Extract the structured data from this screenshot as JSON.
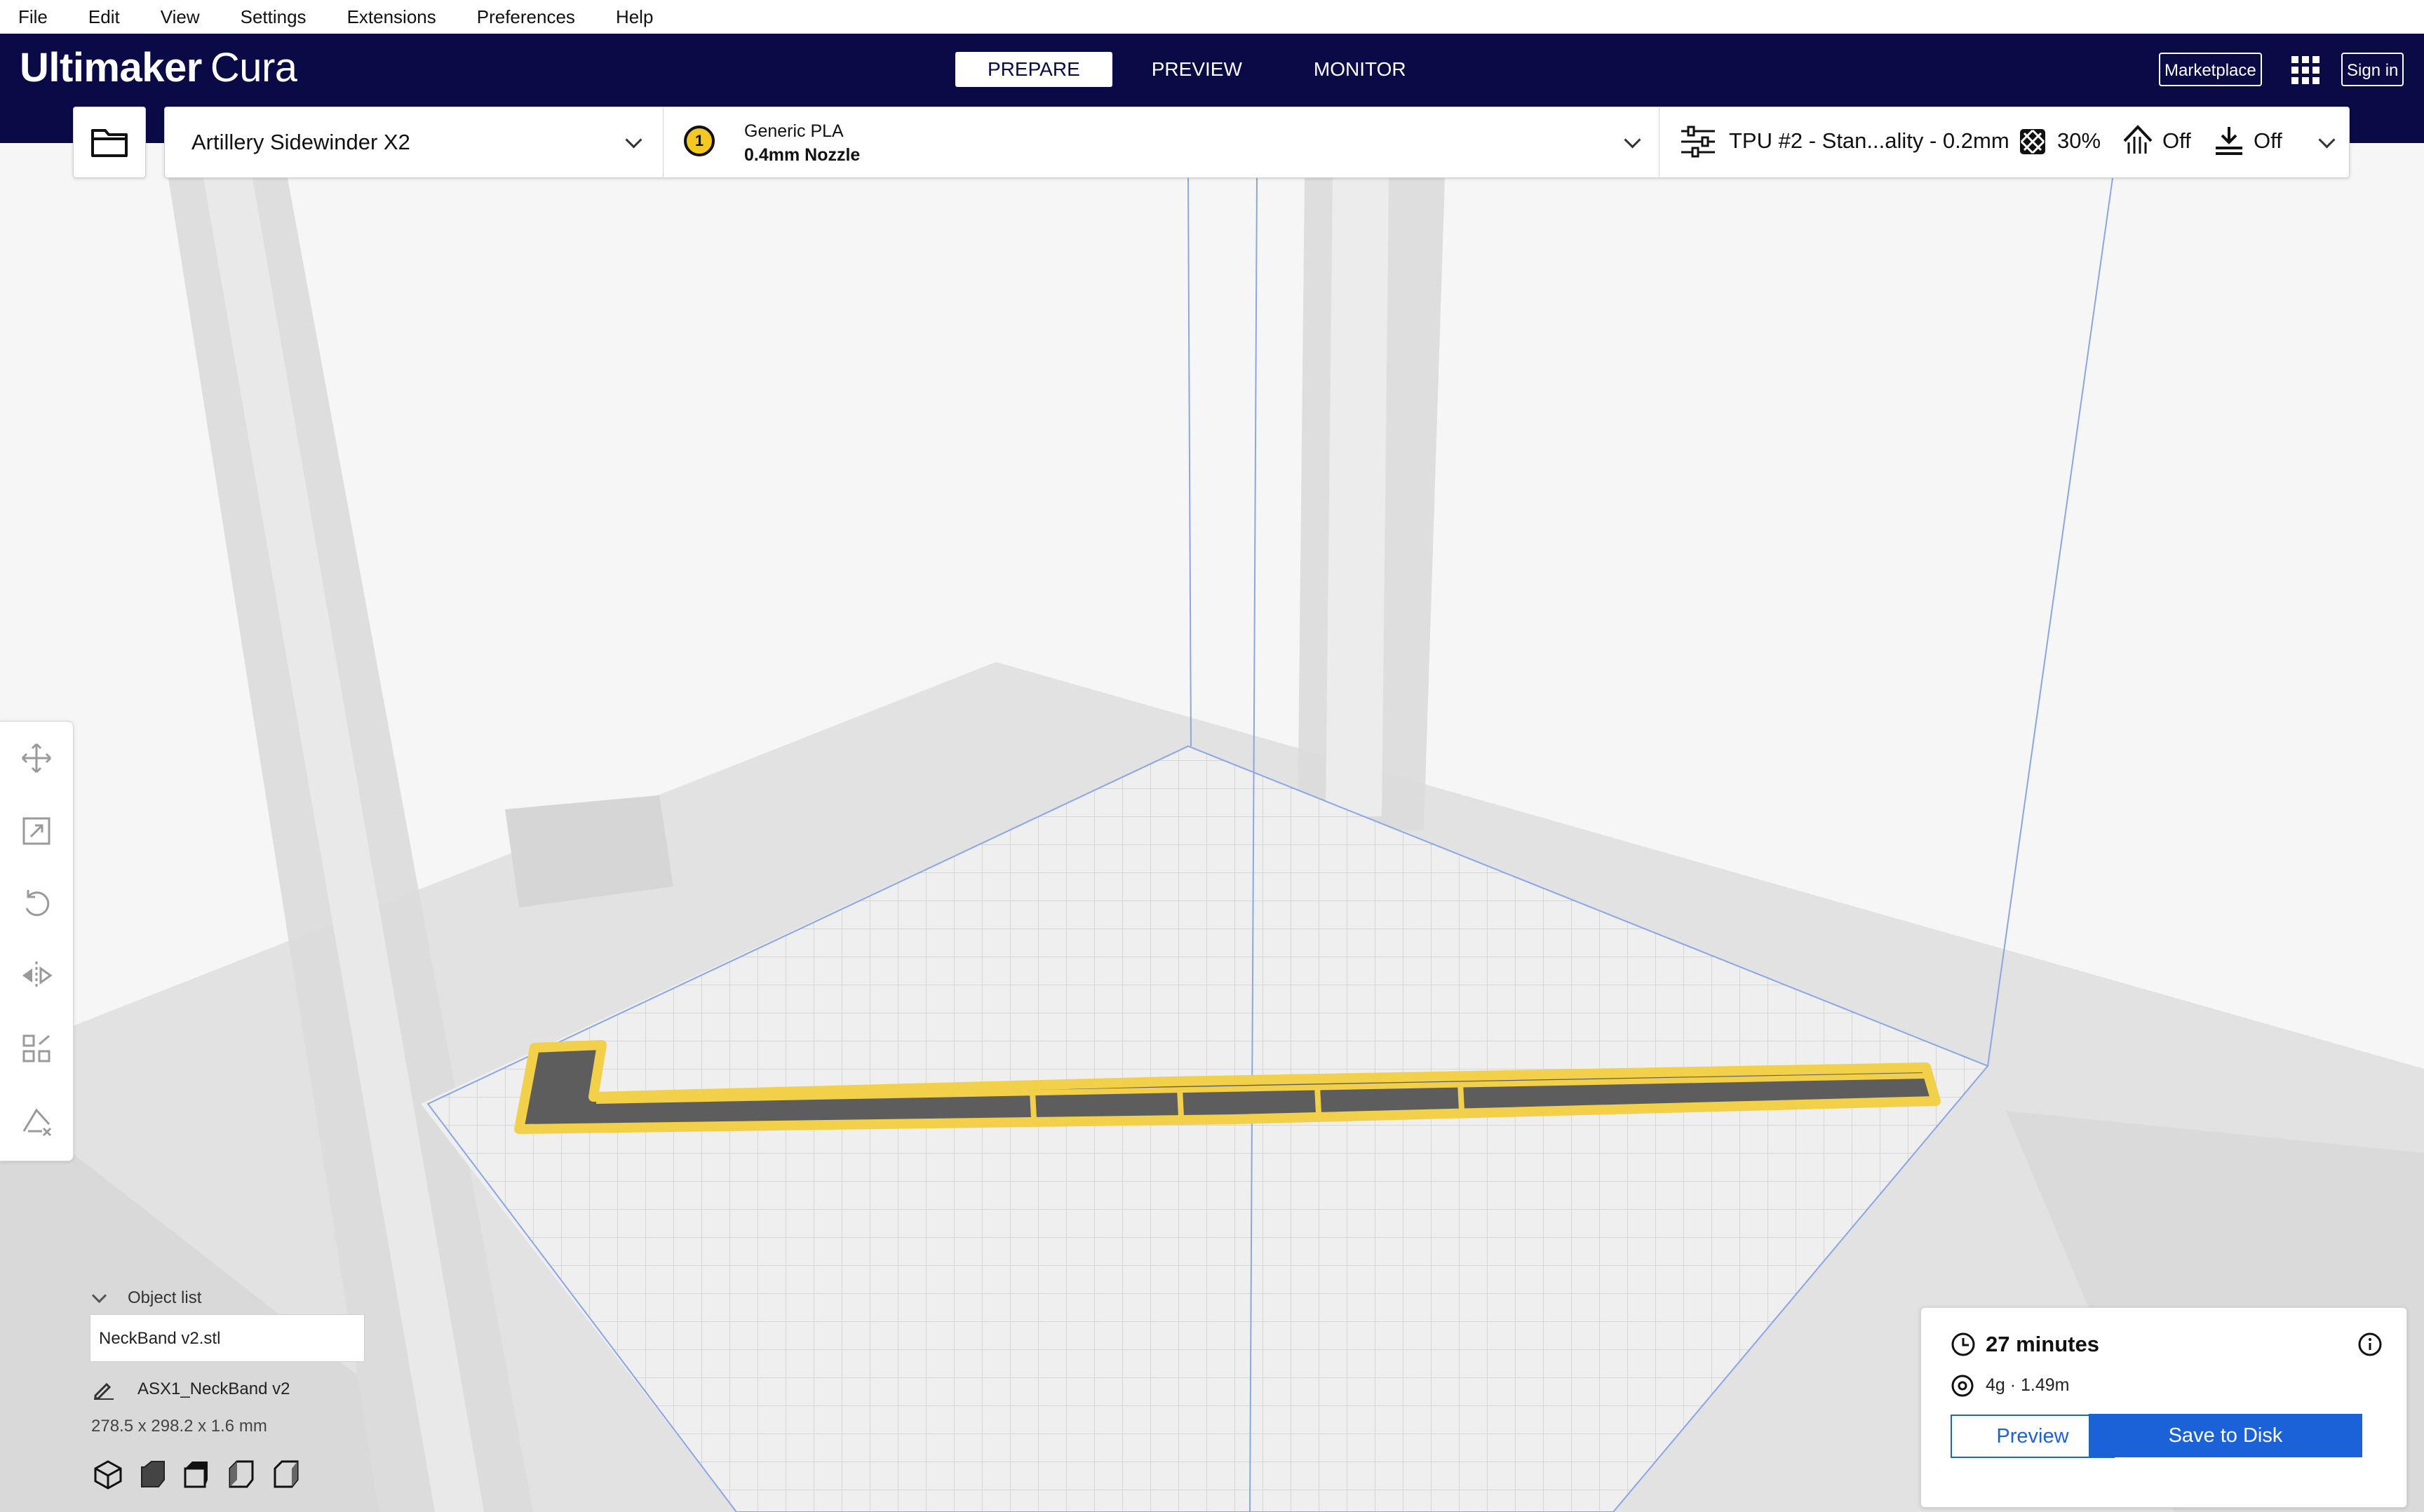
{
  "menu": [
    "File",
    "Edit",
    "View",
    "Settings",
    "Extensions",
    "Preferences",
    "Help"
  ],
  "header": {
    "brand": "Ultimaker",
    "product": "Cura",
    "tabs": [
      "PREPARE",
      "PREVIEW",
      "MONITOR"
    ],
    "active_tab": "PREPARE",
    "marketplace": "Marketplace",
    "sign_in": "Sign in"
  },
  "printer": {
    "name": "Artillery Sidewinder X2",
    "extruder_number": "1",
    "material": "Generic PLA",
    "nozzle": "0.4mm Nozzle"
  },
  "print_settings": {
    "profile": "TPU #2 - Stan...ality - 0.2mm",
    "infill": "30%",
    "support": "Off",
    "adhesion": "Off"
  },
  "object_list": {
    "label": "Object list",
    "items": [
      "NeckBand v2.stl"
    ],
    "selected_name": "ASX1_NeckBand v2",
    "dimensions": "278.5 x 298.2 x 1.6 mm"
  },
  "print_info": {
    "time": "27 minutes",
    "material_usage": "4g · 1.49m",
    "preview_button": "Preview",
    "save_button": "Save to Disk"
  },
  "colors": {
    "header_bg": "#0a0a47",
    "accent_blue": "#1b62d8",
    "model_yellow": "#f2d04a",
    "model_fill": "#5d5d5d"
  },
  "icons": [
    "open-folder-icon",
    "extruder-badge-icon",
    "print-settings-icon",
    "infill-icon",
    "support-icon",
    "adhesion-icon",
    "apps-grid-icon",
    "move-tool-icon",
    "scale-tool-icon",
    "rotate-tool-icon",
    "mirror-tool-icon",
    "per-model-settings-icon",
    "support-blocker-icon",
    "clock-icon",
    "info-icon",
    "spool-icon",
    "pencil-icon",
    "view-3d-icon",
    "view-front-icon",
    "view-top-icon",
    "view-left-icon",
    "view-right-icon"
  ]
}
